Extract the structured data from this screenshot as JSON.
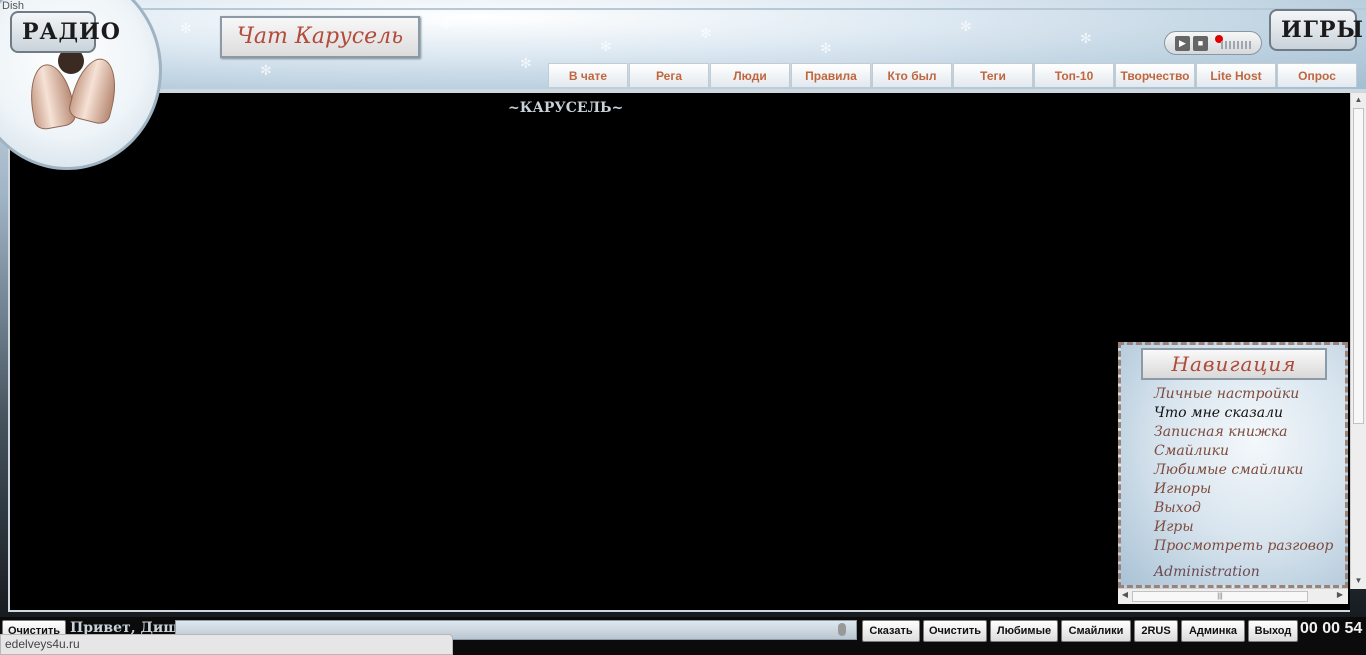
{
  "window": {
    "title": "Dish"
  },
  "header": {
    "radio_label": "РАДИО",
    "games_label": "ИГРЫ",
    "chat_title": "Чат Карусель",
    "nav_tabs": [
      "В чате",
      "Рега",
      "Люди",
      "Правила",
      "Кто был",
      "Теги",
      "Топ-10",
      "Творчество",
      "Lite Host",
      "Опрос"
    ]
  },
  "chat": {
    "room_title": "~КАРУСЕЛЬ~"
  },
  "navigation": {
    "heading": "Навигация",
    "items": [
      "Личные настройки",
      "Что мне сказали",
      "Записная книжка",
      "Смайлики",
      "Любимые смайлики",
      "Игноры",
      "Выход",
      "Игры",
      "Просмотреть разговор",
      "Administration"
    ]
  },
  "bottom": {
    "clear_left_label": "Очистить",
    "greeting": "Привет, Диш!",
    "buttons": [
      "Сказать",
      "Очистить",
      "Любимые",
      "Смайлики",
      "2RUS",
      "Админка",
      "Выход"
    ],
    "timer": "00 00 54"
  },
  "statusbar": {
    "url": "edelveys4u.ru"
  },
  "colors": {
    "nav_tab_text": "#c0663f",
    "chat_bg": "#000000",
    "title_text": "#b34a3a"
  },
  "icons": {
    "play": "play-icon",
    "stop": "stop-icon",
    "record": "record-icon",
    "mic": "microphone-icon"
  }
}
